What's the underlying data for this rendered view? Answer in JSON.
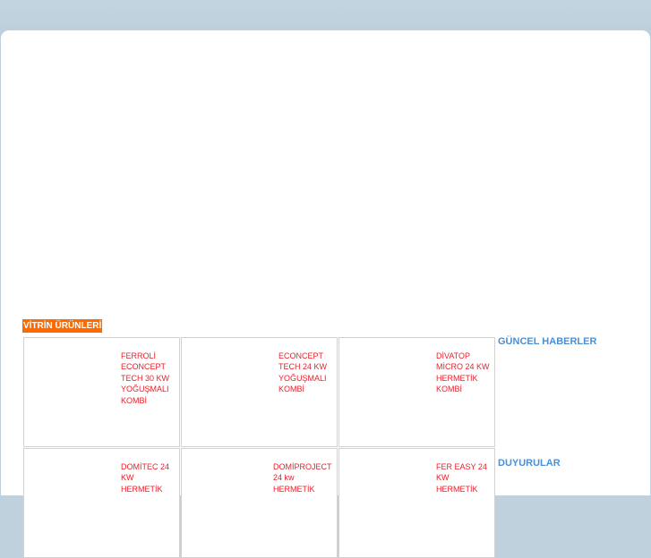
{
  "showcase": {
    "title": "VİTRİN ÜRÜNLERİ",
    "products": [
      {
        "name": "FERROLİ ECONCEPT TECH 30 KW YOĞUŞMALI KOMBİ"
      },
      {
        "name": "ECONCEPT TECH 24 KW YOĞUŞMALI KOMBİ"
      },
      {
        "name": "DİVATOP MİCRO 24 KW HERMETİK KOMBİ"
      },
      {
        "name": "DOMİTEC 24 KW HERMETİK"
      },
      {
        "name": "DOMİPROJECT 24 kw HERMETİK"
      },
      {
        "name": "FER EASY 24 KW HERMETİK"
      }
    ]
  },
  "sidebar": {
    "news_title": "GÜNCEL HABERLER",
    "announcements_title": "DUYURULAR"
  },
  "colors": {
    "header_bg": "#ff6a00",
    "product_link": "#e8202a",
    "sidebar_heading": "#4a90d6",
    "page_background": "#bfd1dd"
  }
}
